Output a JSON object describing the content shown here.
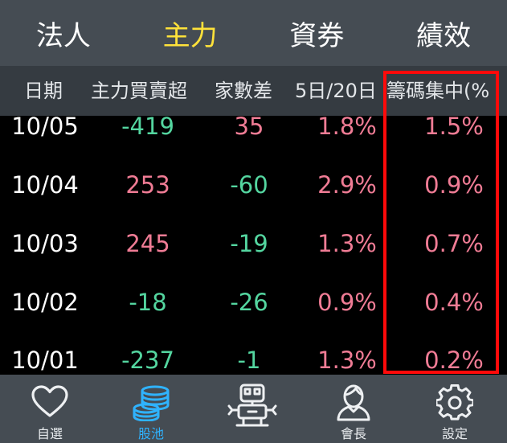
{
  "tabs": [
    {
      "label": "法人",
      "active": false
    },
    {
      "label": "主力",
      "active": true
    },
    {
      "label": "資券",
      "active": false
    },
    {
      "label": "績效",
      "active": false
    }
  ],
  "columns": [
    "日期",
    "主力買賣超",
    "家數差",
    "5日/20日",
    "籌碼集中(%"
  ],
  "rows": [
    {
      "date": "10/05",
      "net": "-419",
      "diff": "35",
      "ratio": "1.8%",
      "conc": "1.5%"
    },
    {
      "date": "10/04",
      "net": "253",
      "diff": "-60",
      "ratio": "2.9%",
      "conc": "0.9%"
    },
    {
      "date": "10/03",
      "net": "245",
      "diff": "-19",
      "ratio": "1.3%",
      "conc": "0.7%"
    },
    {
      "date": "10/02",
      "net": "-18",
      "diff": "-26",
      "ratio": "0.9%",
      "conc": "0.4%"
    },
    {
      "date": "10/01",
      "net": "-237",
      "diff": "-1",
      "ratio": "1.3%",
      "conc": "0.2%"
    }
  ],
  "nav": [
    {
      "label": "自選",
      "icon": "heart-icon",
      "active": false
    },
    {
      "label": "股池",
      "icon": "coins-icon",
      "active": true
    },
    {
      "label": "",
      "icon": "robot-icon",
      "active": false
    },
    {
      "label": "會長",
      "icon": "user-icon",
      "active": false
    },
    {
      "label": "設定",
      "icon": "gear-icon",
      "active": false
    }
  ],
  "colors": {
    "positive": "#f07c95",
    "negative": "#54d6a0",
    "accent": "#ffe23a",
    "nav_active": "#2fb3ff",
    "highlight": "#ff0a0a"
  }
}
